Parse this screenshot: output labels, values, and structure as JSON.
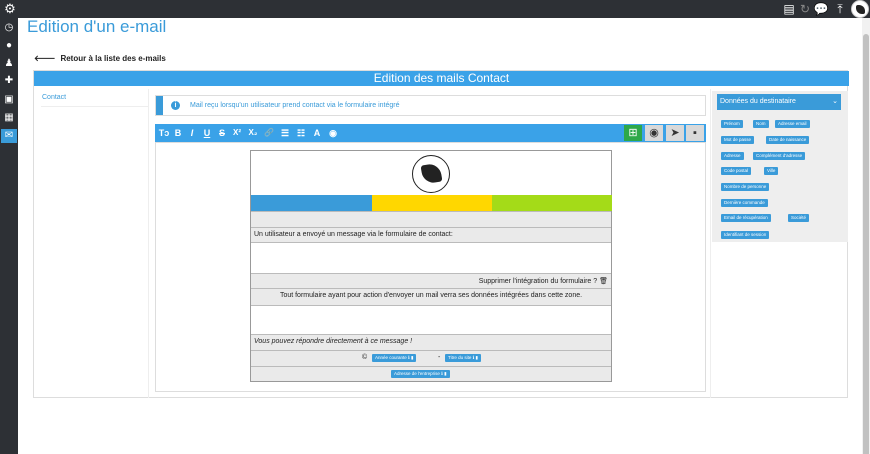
{
  "page": {
    "title": "Edition d'un e-mail",
    "back_link": "Retour à la liste des e-mails"
  },
  "panel": {
    "header": "Edition des mails Contact",
    "tab": "Contact",
    "description": "Mail reçu lorsqu'un utilisateur prend contact via le formulaire intégré"
  },
  "toolbar": {
    "buttons": [
      "Tↄ",
      "B",
      "I",
      "U",
      "S",
      "X²",
      "X₂",
      "🔗",
      "☰",
      "☷",
      "A",
      "◉"
    ]
  },
  "mail": {
    "blank1": "",
    "intro": "Un utilisateur a envoyé un message via le formulaire de contact:",
    "remove_integration": "Supprimer l'intégration du formulaire ?",
    "form_notice": "Tout formulaire ayant pour action d'envoyer un mail verra ses données intégrées dans cette zone.",
    "reply_hint": "Vous pouvez répondre directement à ce message !",
    "copyright_symbol": "©",
    "tag_year": "Année courante",
    "tag_site": "Titre du site",
    "tag_address": "Adresse de l'entreprise",
    "separator": "-",
    "colors": {
      "blue": "#3a9bd9",
      "yellow": "#ffd700",
      "green": "#a4db18"
    }
  },
  "side": {
    "select": "Données du destinataire",
    "tags": [
      "Prénom",
      "Nom",
      "Adresse email",
      "Mot de passe",
      "Date de naissance",
      "Adresse",
      "Complément d'adresse",
      "Code postal",
      "Ville",
      "Nombre de personne",
      "Dernière commande",
      "Email de récupération",
      "Société",
      "Identifiant de session"
    ]
  },
  "colors": {
    "accent": "#3aa2e8",
    "sidebar": "#2d3035",
    "toolbar_green": "#2ea84a"
  }
}
